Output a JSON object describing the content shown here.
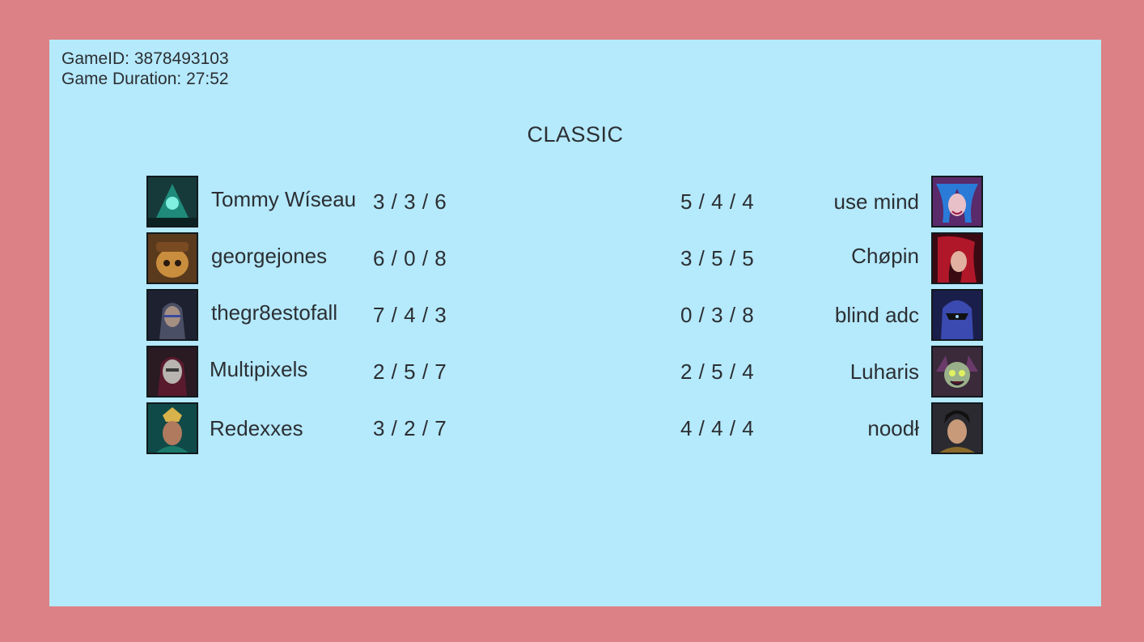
{
  "game": {
    "id_text": "GameID: 3878493103",
    "duration_text": "Game Duration: 27:52",
    "mode": "CLASSIC"
  },
  "teams": {
    "blue": [
      {
        "name": "Tommy Wíseau",
        "kda": "3 / 3 / 6",
        "avatar_icon": "champion-portrait-icon"
      },
      {
        "name": "georgejones",
        "kda": "6 / 0 / 8",
        "avatar_icon": "champion-portrait-icon"
      },
      {
        "name": "thegr8estofall",
        "kda": "7 / 4 / 3",
        "avatar_icon": "champion-portrait-icon"
      },
      {
        "name": "Multipixels",
        "kda": "2 / 5 / 7",
        "avatar_icon": "champion-portrait-icon"
      },
      {
        "name": "Redexxes",
        "kda": "3 / 2 / 7",
        "avatar_icon": "champion-portrait-icon"
      }
    ],
    "red": [
      {
        "name": "use mind",
        "kda": "5 / 4 / 4",
        "avatar_icon": "champion-portrait-icon"
      },
      {
        "name": "Chøpin",
        "kda": "3 / 5 / 5",
        "avatar_icon": "champion-portrait-icon"
      },
      {
        "name": "blind adc",
        "kda": "0 / 3 / 8",
        "avatar_icon": "champion-portrait-icon"
      },
      {
        "name": "Luharis",
        "kda": "2 / 5 / 4",
        "avatar_icon": "champion-portrait-icon"
      },
      {
        "name": "noodł",
        "kda": "4 / 4 / 4",
        "avatar_icon": "champion-portrait-icon"
      }
    ]
  },
  "colors": {
    "page_background": "#dc8185",
    "panel_background": "#b5e9fc",
    "text": "#2b2f33"
  }
}
